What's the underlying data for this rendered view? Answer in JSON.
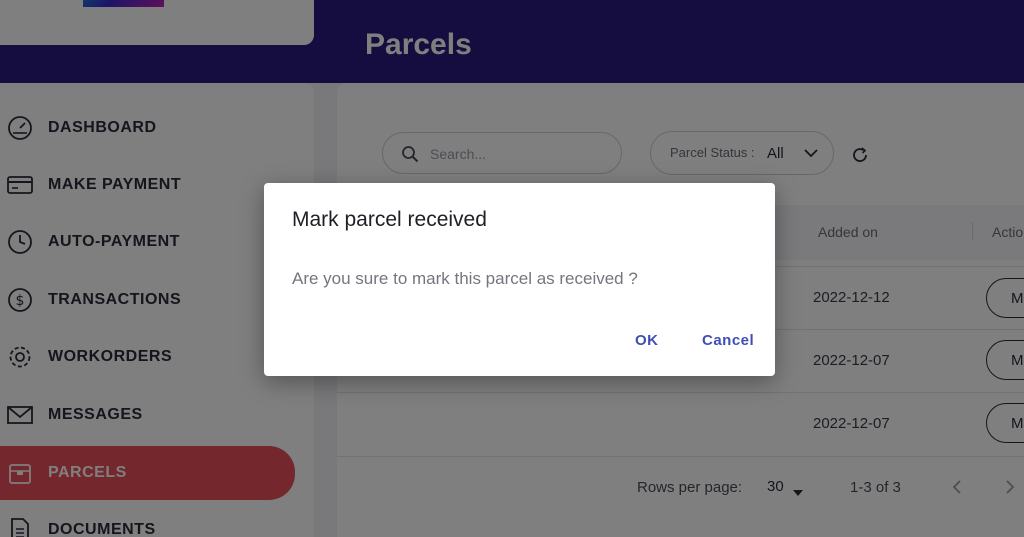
{
  "page_title": "Parcels",
  "sidebar": {
    "items": [
      {
        "label": "DASHBOARD",
        "icon": "speedometer-icon"
      },
      {
        "label": "MAKE PAYMENT",
        "icon": "credit-card-icon"
      },
      {
        "label": "AUTO-PAYMENT",
        "icon": "clock-icon"
      },
      {
        "label": "TRANSACTIONS",
        "icon": "dollar-circle-icon"
      },
      {
        "label": "WORKORDERS",
        "icon": "gear-icon"
      },
      {
        "label": "MESSAGES",
        "icon": "envelope-icon"
      },
      {
        "label": "PARCELS",
        "icon": "package-icon",
        "active": true
      },
      {
        "label": "DOCUMENTS",
        "icon": "document-icon"
      }
    ]
  },
  "toolbar": {
    "search_placeholder": "Search...",
    "status_label": "Parcel Status :",
    "status_value": "All"
  },
  "table": {
    "headers": {
      "added_on": "Added on",
      "action": "Actio"
    },
    "rows": [
      {
        "added_on": "2022-12-12",
        "action_label": "M"
      },
      {
        "added_on": "2022-12-07",
        "action_label": "M"
      },
      {
        "added_on": "2022-12-07",
        "action_label": "M"
      }
    ]
  },
  "pagination": {
    "rows_per_page_label": "Rows per page:",
    "rows_per_page": "30",
    "range": "1-3 of 3"
  },
  "dialog": {
    "title": "Mark parcel received",
    "message": "Are you sure to mark this parcel as received ?",
    "ok_label": "OK",
    "cancel_label": "Cancel"
  },
  "colors": {
    "header": "#2b1a7e",
    "active_nav": "#e8505b",
    "dialog_button": "#3f4fb8"
  }
}
